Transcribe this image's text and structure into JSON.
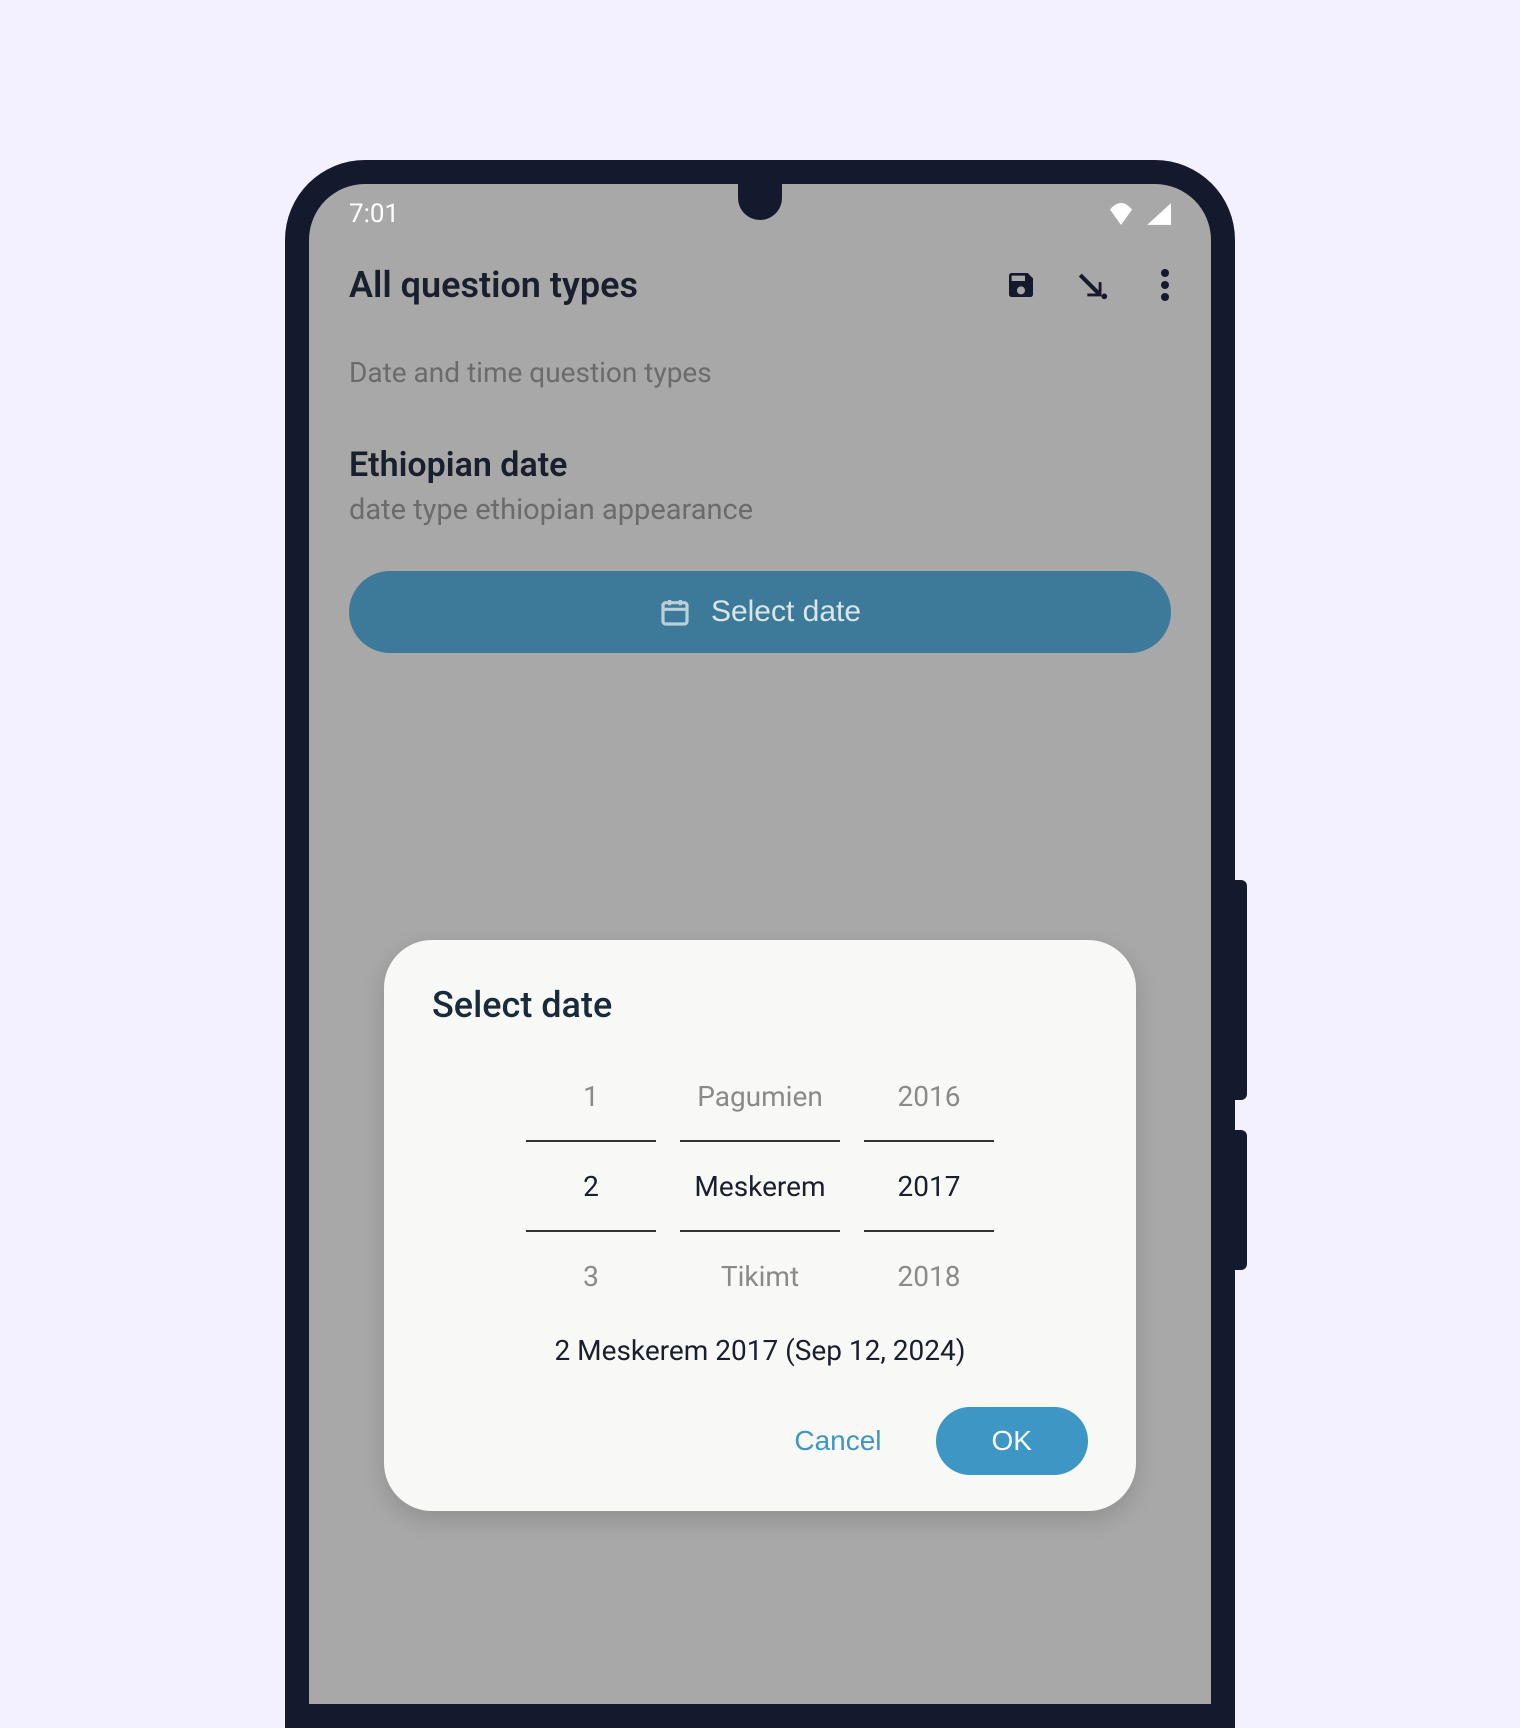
{
  "status": {
    "time": "7:01"
  },
  "appBar": {
    "title": "All question types"
  },
  "section": {
    "header": "Date and time question types",
    "questionTitle": "Ethiopian date",
    "questionHint": "date type ethiopian appearance",
    "selectDateLabel": "Select date"
  },
  "dialog": {
    "title": "Select date",
    "picker": {
      "day": {
        "prev": "1",
        "current": "2",
        "next": "3"
      },
      "month": {
        "prev": "Pagumien",
        "current": "Meskerem",
        "next": "Tikimt"
      },
      "year": {
        "prev": "2016",
        "current": "2017",
        "next": "2018"
      }
    },
    "result": "2 Meskerem 2017 (Sep 12, 2024)",
    "cancelLabel": "Cancel",
    "okLabel": "OK"
  }
}
